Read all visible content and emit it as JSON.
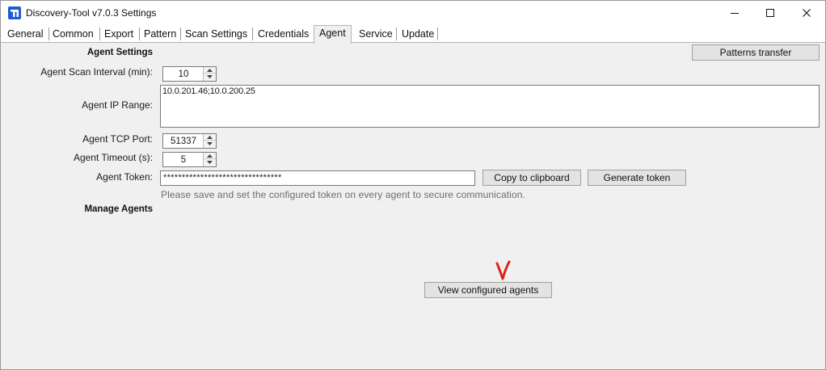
{
  "window": {
    "title": "Discovery-Tool v7.0.3 Settings"
  },
  "tabs": [
    {
      "label": "General"
    },
    {
      "label": "Common"
    },
    {
      "label": "Export"
    },
    {
      "label": "Pattern"
    },
    {
      "label": "Scan Settings"
    },
    {
      "label": "Credentials"
    },
    {
      "label": "Agent",
      "active": true
    },
    {
      "label": "Service"
    },
    {
      "label": "Update"
    }
  ],
  "agent_settings": {
    "section_title": "Agent Settings",
    "patterns_button": "Patterns transfer",
    "scan_interval_label": "Agent Scan Interval (min):",
    "scan_interval_value": "10",
    "ip_range_label": "Agent IP Range:",
    "ip_range_value": "10.0.201.46;10.0.200.25",
    "tcp_port_label": "Agent TCP Port:",
    "tcp_port_value": "51337",
    "timeout_label": "Agent Timeout (s):",
    "timeout_value": "5",
    "token_label": "Agent Token:",
    "token_value": "********************************",
    "copy_button": "Copy to clipboard",
    "generate_button": "Generate token",
    "token_hint": "Please save and set the configured token on every agent to secure communication."
  },
  "manage_agents": {
    "section_title": "Manage Agents",
    "view_button": "View configured agents"
  },
  "annotation": {
    "text": "V",
    "color": "#e0201b"
  },
  "colors": {
    "window_bg": "#f0f0f0",
    "titlebar_bg": "#ffffff",
    "app_icon": "#1f5bd6",
    "hint_text": "#6b6b6b"
  }
}
